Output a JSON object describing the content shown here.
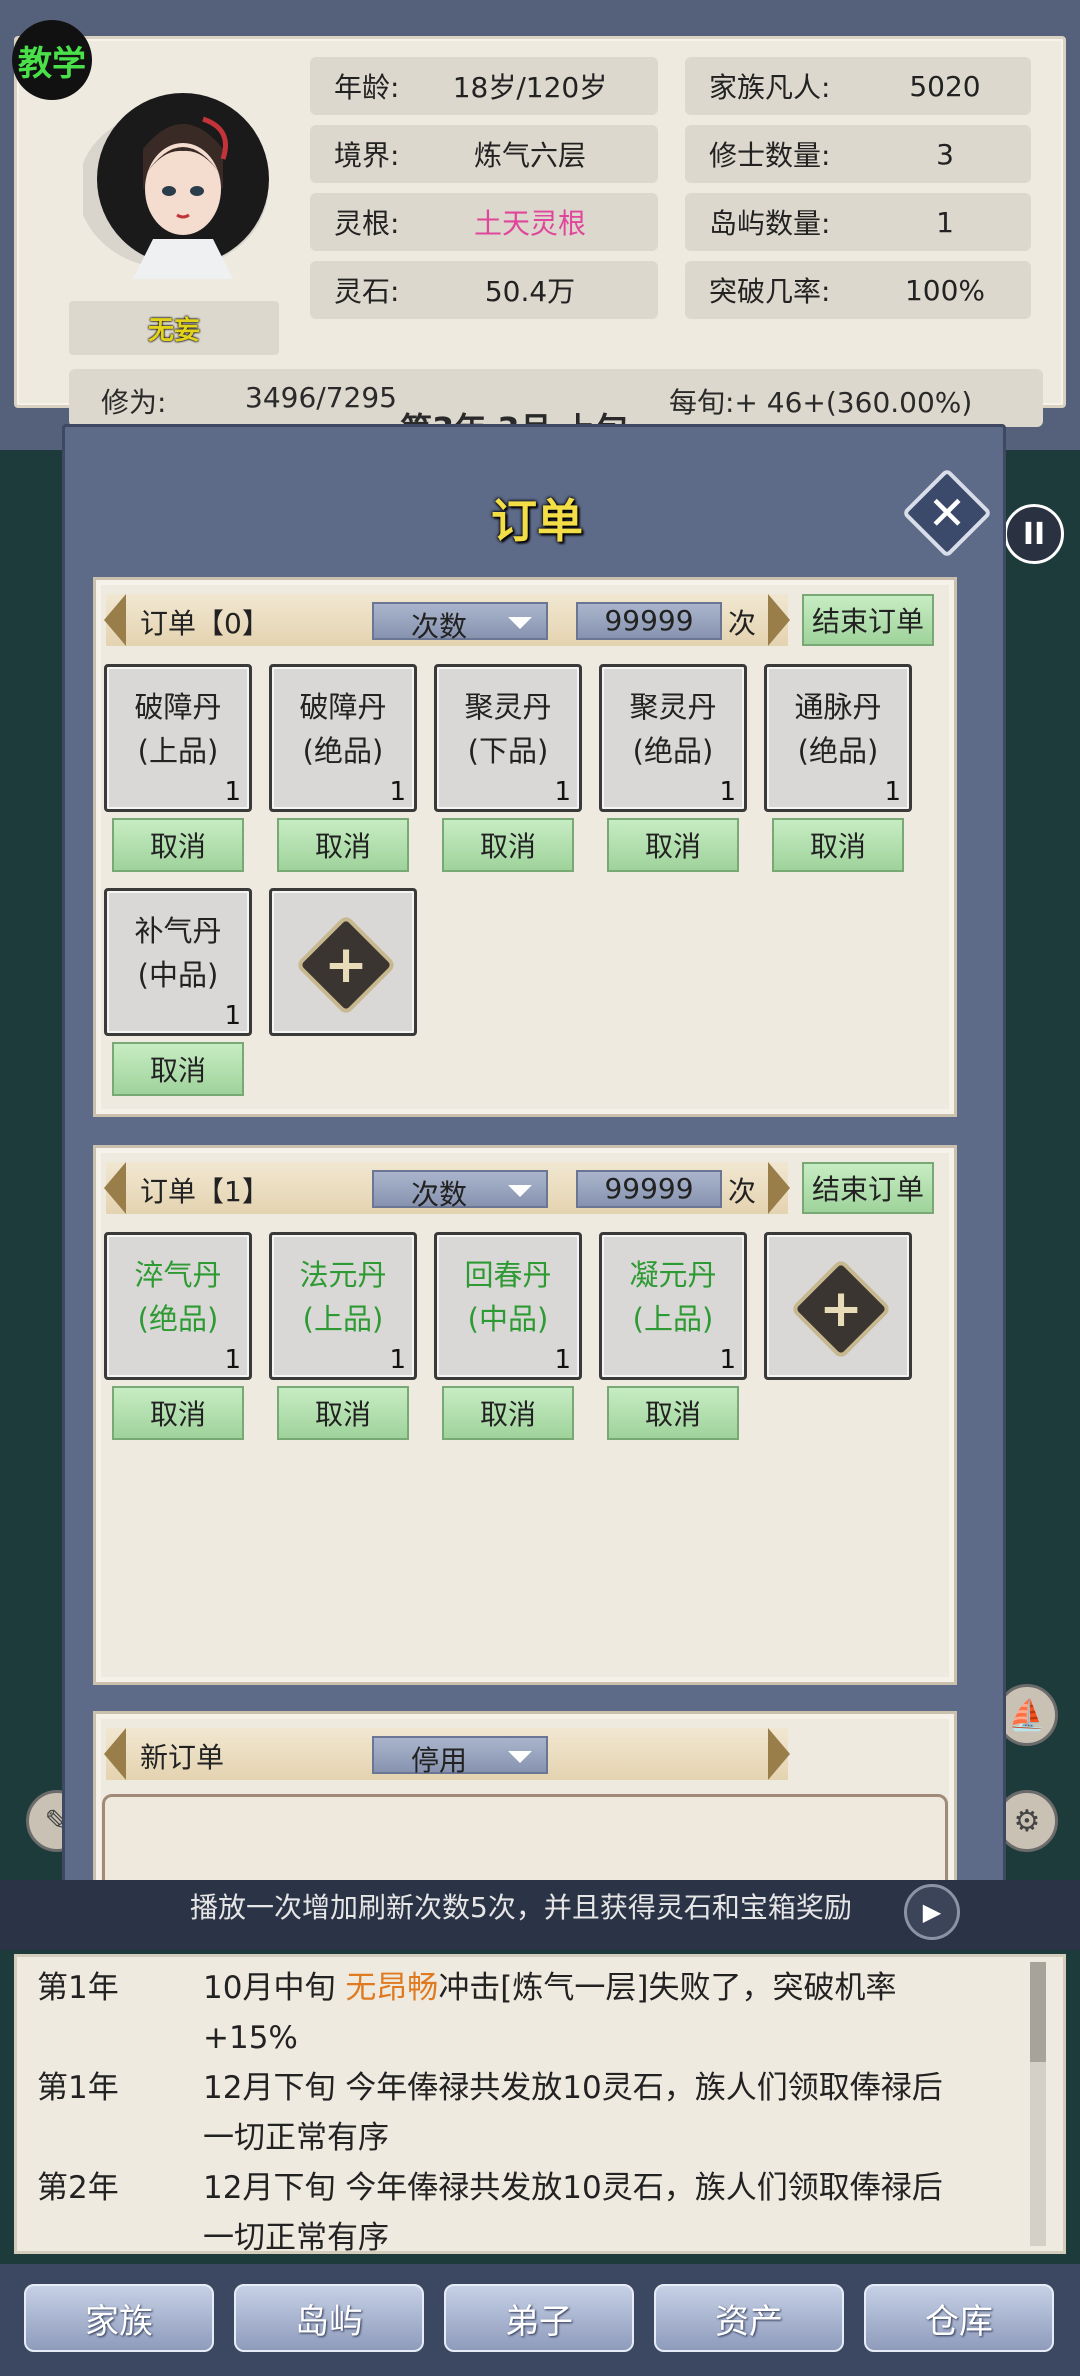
{
  "status": {
    "tutorial_badge": "教学",
    "character_name": "无妄",
    "age_label": "年龄:",
    "age_value": "18岁/120岁",
    "realm_label": "境界:",
    "realm_value": "炼气六层",
    "root_label": "灵根:",
    "root_value": "土天灵根",
    "stones_label": "灵石:",
    "stones_value": "50.4万",
    "mortals_label": "家族凡人:",
    "mortals_value": "5020",
    "cultivators_label": "修士数量:",
    "cultivators_value": "3",
    "islands_label": "岛屿数量:",
    "islands_value": "1",
    "breakthrough_label": "突破几率:",
    "breakthrough_value": "100%",
    "cultivation_label": "修为:",
    "cultivation_value": "3496/7295",
    "per_period": "每旬:+ 46+(360.00%)"
  },
  "background": {
    "date_partial": "第3年 3月 上旬"
  },
  "modal": {
    "title": "订单",
    "orders": [
      {
        "name": "订单【0】",
        "mode": "次数",
        "count": "99999",
        "count_unit": "次",
        "end_label": "结束订单",
        "items": [
          {
            "line1": "破障丹",
            "line2": "(上品)",
            "qty": "1",
            "cancel": "取消",
            "green": false
          },
          {
            "line1": "破障丹",
            "line2": "(绝品)",
            "qty": "1",
            "cancel": "取消",
            "green": false
          },
          {
            "line1": "聚灵丹",
            "line2": "(下品)",
            "qty": "1",
            "cancel": "取消",
            "green": false
          },
          {
            "line1": "聚灵丹",
            "line2": "(绝品)",
            "qty": "1",
            "cancel": "取消",
            "green": false
          },
          {
            "line1": "通脉丹",
            "line2": "(绝品)",
            "qty": "1",
            "cancel": "取消",
            "green": false
          },
          {
            "line1": "补气丹",
            "line2": "(中品)",
            "qty": "1",
            "cancel": "取消",
            "green": false
          }
        ]
      },
      {
        "name": "订单【1】",
        "mode": "次数",
        "count": "99999",
        "count_unit": "次",
        "end_label": "结束订单",
        "items": [
          {
            "line1": "淬气丹",
            "line2": "(绝品)",
            "qty": "1",
            "cancel": "取消",
            "green": true
          },
          {
            "line1": "法元丹",
            "line2": "(上品)",
            "qty": "1",
            "cancel": "取消",
            "green": true
          },
          {
            "line1": "回春丹",
            "line2": "(中品)",
            "qty": "1",
            "cancel": "取消",
            "green": true
          },
          {
            "line1": "凝元丹",
            "line2": "(上品)",
            "qty": "1",
            "cancel": "取消",
            "green": true
          }
        ]
      }
    ],
    "new_order": {
      "name": "新订单",
      "mode": "停用"
    }
  },
  "ticker": "播放一次增加刷新次数5次，并且获得灵石和宝箱奖励",
  "log": [
    {
      "year": "第1年",
      "pre": "10月中旬 ",
      "highlight": "无昂畅",
      "post": "冲击[炼气一层]失败了，突破机率",
      "line2": "+15%"
    },
    {
      "year": "第1年",
      "pre": "12月下旬 今年俸禄共发放10灵石，族人们领取俸禄后",
      "highlight": "",
      "post": "",
      "line2": "一切正常有序"
    },
    {
      "year": "第2年",
      "pre": "12月下旬 今年俸禄共发放10灵石，族人们领取俸禄后",
      "highlight": "",
      "post": "",
      "line2": "一切正常有序"
    }
  ],
  "nav": [
    "家族",
    "岛屿",
    "弟子",
    "资产",
    "仓库"
  ],
  "colors": {
    "accent_title": "#f3de48",
    "root_pink": "#e0469b",
    "green_pill": "#2e9a33",
    "log_highlight": "#e07a21"
  }
}
